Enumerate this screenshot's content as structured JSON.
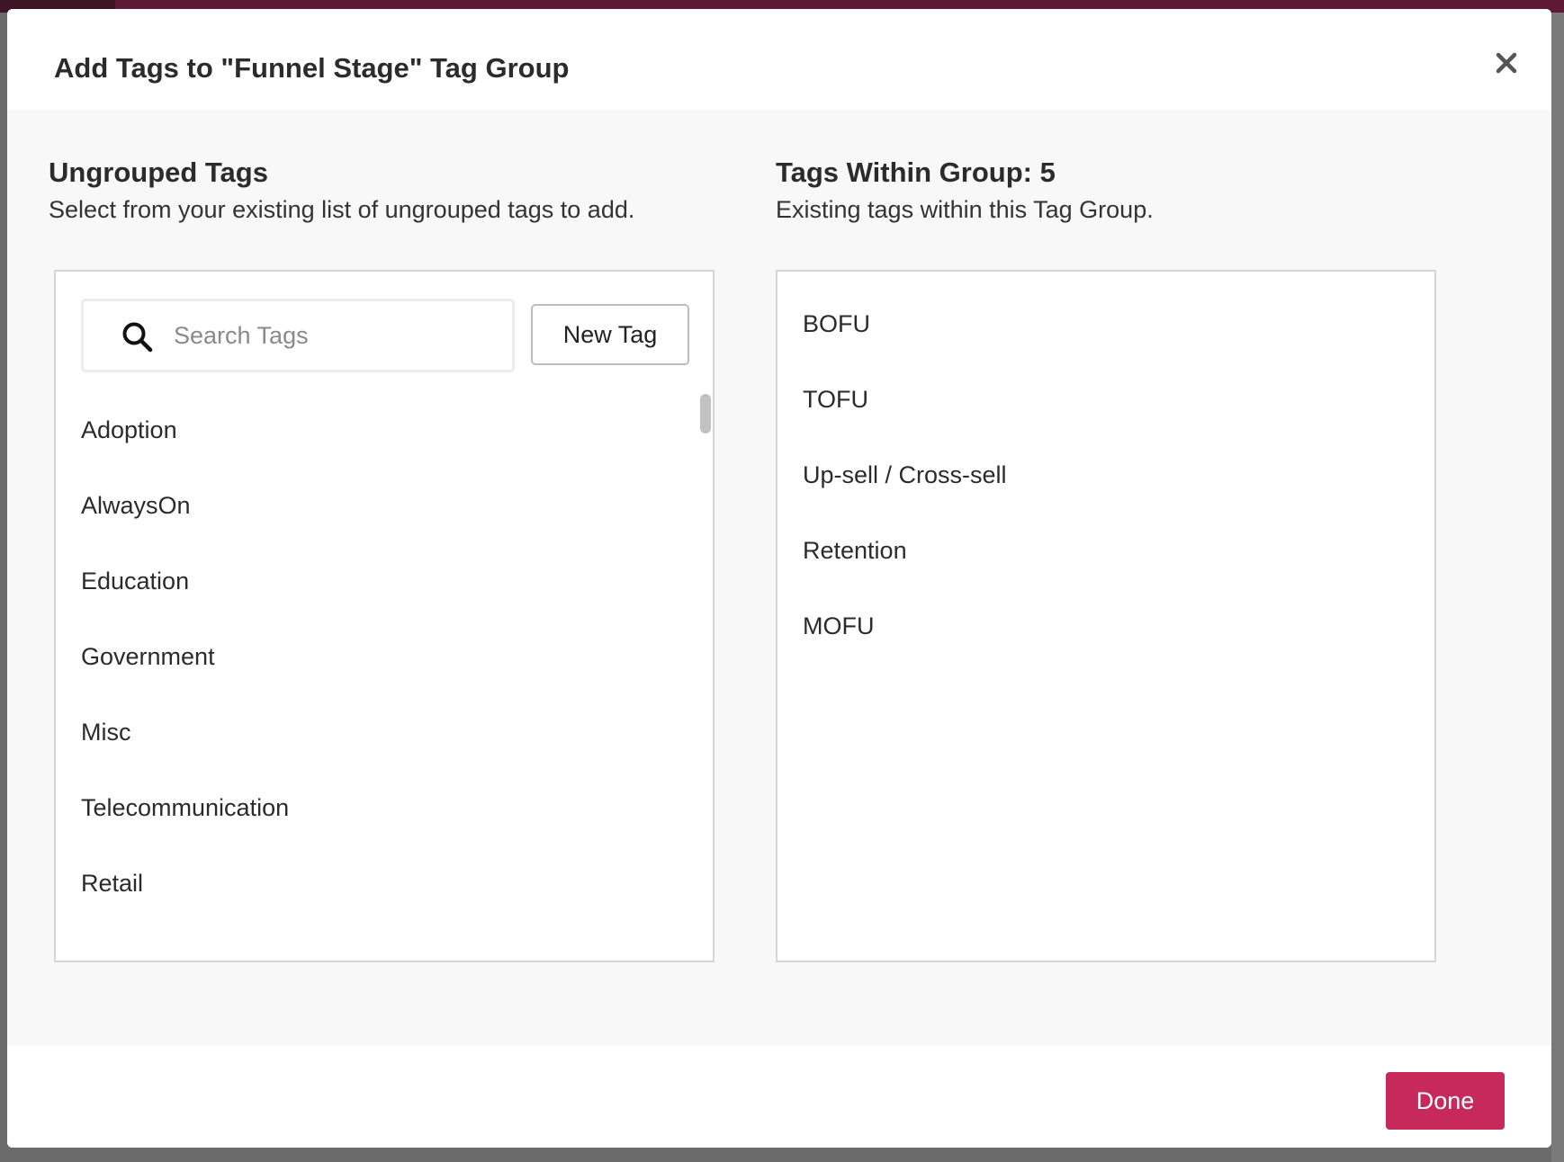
{
  "modal": {
    "title": "Add Tags to \"Funnel Stage\" Tag Group"
  },
  "ungrouped": {
    "title": "Ungrouped Tags",
    "subtitle": "Select from your existing list of ungrouped tags to add.",
    "search_placeholder": "Search Tags",
    "new_tag_label": "New Tag",
    "tags": [
      "Adoption",
      "AlwaysOn",
      "Education",
      "Government",
      "Misc",
      "Telecommunication",
      "Retail"
    ]
  },
  "grouped": {
    "title": "Tags Within Group: 5",
    "subtitle": "Existing tags within this Tag Group.",
    "tags": [
      "BOFU",
      "TOFU",
      "Up-sell / Cross-sell",
      "Retention",
      "MOFU"
    ]
  },
  "footer": {
    "done_label": "Done"
  },
  "colors": {
    "accent": "#c72a5a",
    "app_bar": "#5e1a34"
  },
  "icons": {
    "close": "close-icon",
    "search": "search-icon"
  }
}
